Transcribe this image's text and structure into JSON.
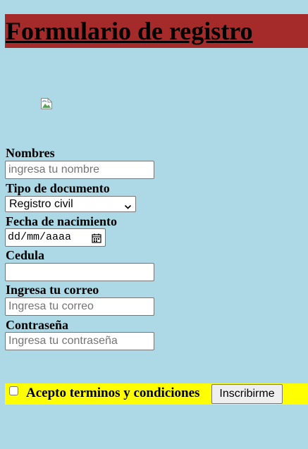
{
  "header": {
    "title": "Formulario de registro"
  },
  "image": {
    "icon": "broken-image-icon"
  },
  "form": {
    "nombres": {
      "label": "Nombres",
      "placeholder": "ingresa tu nombre",
      "value": ""
    },
    "tipo_documento": {
      "label": "Tipo de documento",
      "selected": "Registro civil"
    },
    "fecha_nacimiento": {
      "label": "Fecha de nacimiento",
      "value": "dd/mm/aaaa",
      "icon": "calendar-icon"
    },
    "cedula": {
      "label": "Cedula",
      "placeholder": "",
      "value": ""
    },
    "correo": {
      "label": "Ingresa tu correo",
      "placeholder": "Ingresa tu correo",
      "value": ""
    },
    "contrasena": {
      "label": "Contraseña",
      "placeholder": "Ingresa tu contraseña",
      "value": ""
    },
    "terminos": {
      "label": "Acepto terminos y condiciones",
      "checked": false
    },
    "submit_label": "Inscribirme"
  },
  "colors": {
    "page_background": "#add8e6",
    "header_background": "#a52a2a",
    "terms_background": "#ffff00"
  }
}
